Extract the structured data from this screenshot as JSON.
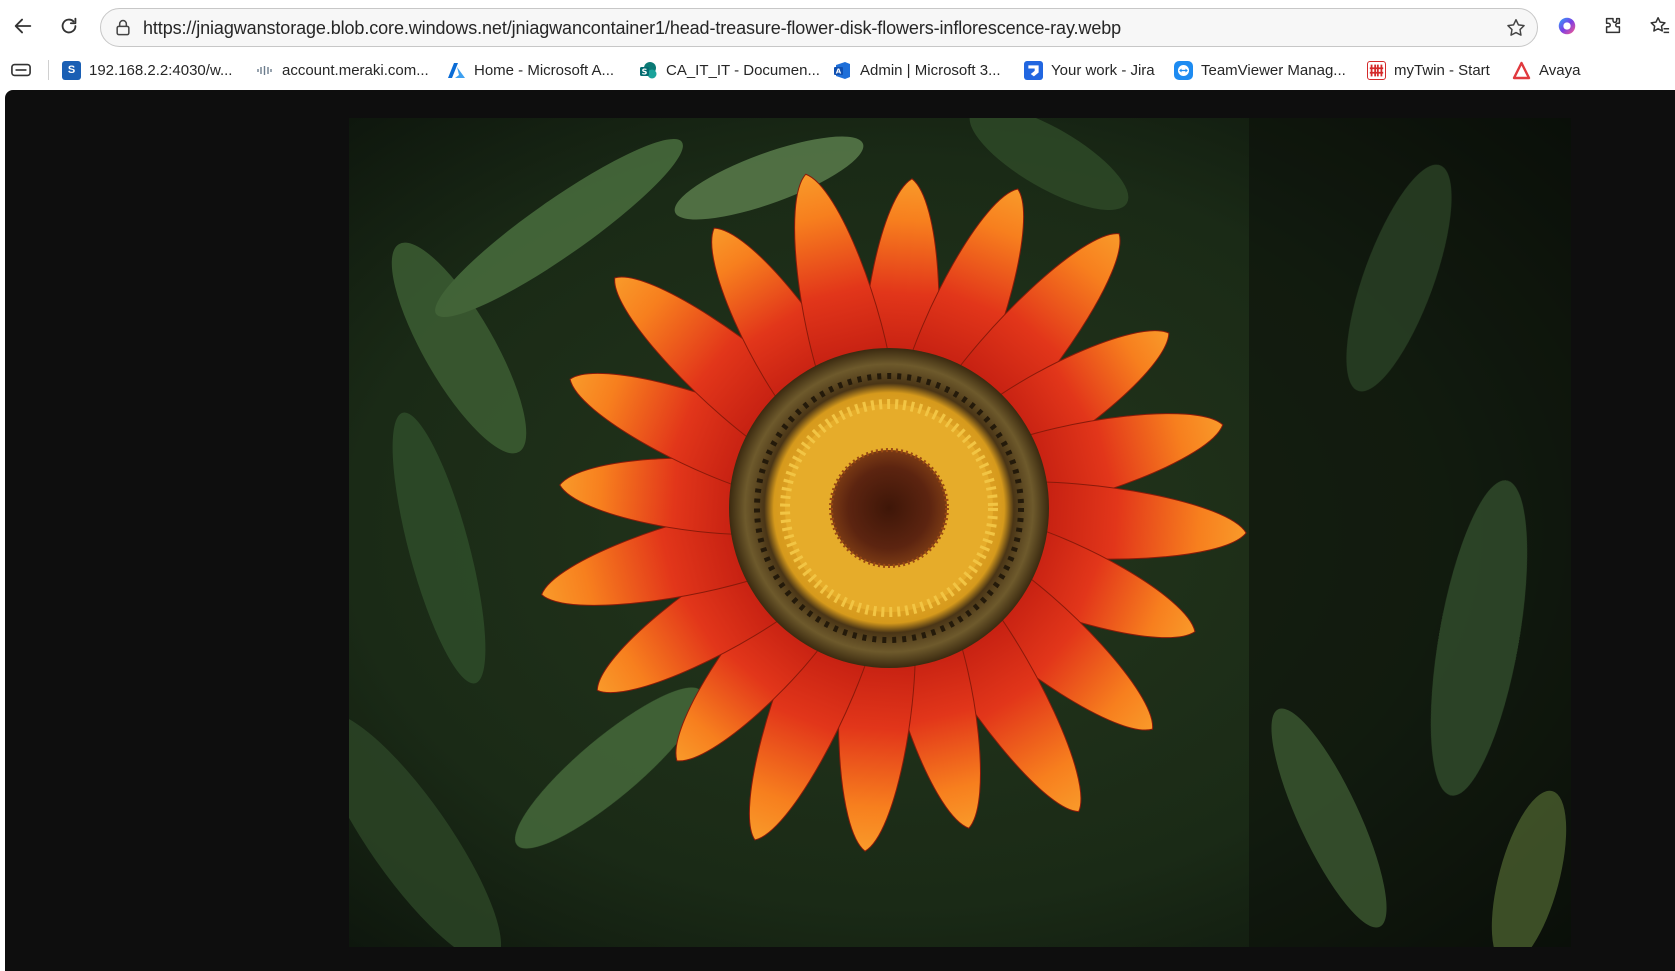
{
  "browser": {
    "url": "https://jniagwanstorage.blob.core.windows.net/jniagwancontainer1/head-treasure-flower-disk-flowers-inflorescence-ray.webp",
    "toolbar_icons": [
      "back-icon",
      "reload-icon",
      "lock-icon",
      "star-icon",
      "copilot-icon",
      "extensions-icon",
      "favorites-icon"
    ]
  },
  "bookmarks": [
    {
      "label": "192.168.2.2:4030/w...",
      "icon": "s-icon",
      "color": "#1a5fb4"
    },
    {
      "label": "account.meraki.com...",
      "icon": "cisco-icon",
      "color": "#6b7c8c"
    },
    {
      "label": "Home - Microsoft A...",
      "icon": "azure-icon",
      "color": "#0a6cd6"
    },
    {
      "label": "CA_IT_IT - Documen...",
      "icon": "sharepoint-icon",
      "color": "#0b7a75"
    },
    {
      "label": "Admin | Microsoft 3...",
      "icon": "office-admin-icon",
      "color": "#1e6fd9"
    },
    {
      "label": "Your work - Jira",
      "icon": "jira-icon",
      "color": "#2166e0"
    },
    {
      "label": "TeamViewer Manag...",
      "icon": "teamviewer-icon",
      "color": "#1d8bf1"
    },
    {
      "label": "myTwin - Start",
      "icon": "mytwin-icon",
      "color": "#d42a2a"
    },
    {
      "label": "Avaya",
      "icon": "avaya-icon",
      "color": "#e0393e"
    }
  ],
  "image": {
    "subject": "flower-photo",
    "colors": {
      "petal_outer": "#f7921e",
      "petal_inner": "#d42a14",
      "center": "#5a2410",
      "pollen": "#e6a820",
      "foliage": "#2f4a26"
    }
  }
}
